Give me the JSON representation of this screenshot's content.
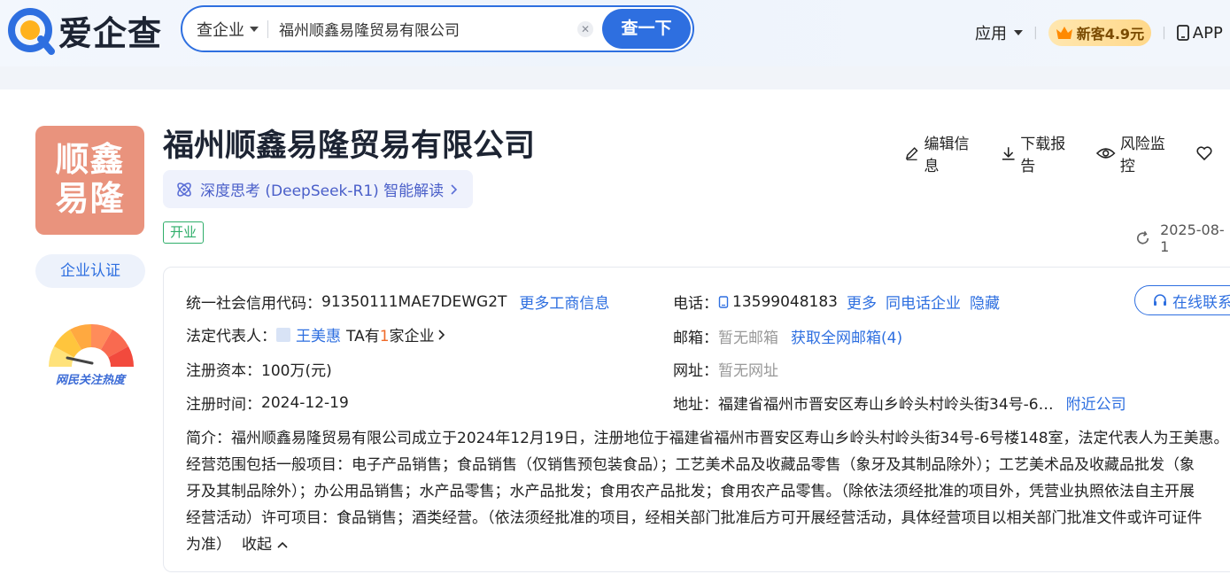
{
  "header": {
    "logo_text": "爱企查",
    "search_type": "查企业",
    "search_value": "福州顺鑫易隆贸易有限公司",
    "search_button": "查一下",
    "apps_label": "应用",
    "vip_label": "新客4.9元",
    "app_label": "APP"
  },
  "company": {
    "logo_line1": "顺鑫",
    "logo_line2": "易隆",
    "name": "福州顺鑫易隆贸易有限公司",
    "ai_label": "深度思考 (DeepSeek-R1) 智能解读",
    "status": "开业",
    "cert_label": "企业认证",
    "heat_label": "网民关注热度",
    "update_date": "2025-08-1"
  },
  "actions": {
    "edit": "编辑信息",
    "download": "下载报告",
    "monitor": "风险监控"
  },
  "info": {
    "credit_code_label": "统一社会信用代码：",
    "credit_code": "91350111MAE7DEWG2T",
    "more_business": "更多工商信息",
    "legal_rep_label": "法定代表人：",
    "legal_rep": "王美惠",
    "ta_prefix": "TA有",
    "ta_count": "1",
    "ta_suffix": "家企业",
    "capital_label": "注册资本：",
    "capital": "100万(元)",
    "reg_date_label": "注册时间：",
    "reg_date": "2024-12-19",
    "phone_label": "电话：",
    "phone": "13599048183",
    "phone_more": "更多",
    "same_phone": "同电话企业",
    "hide": "隐藏",
    "email_label": "邮箱：",
    "email": "暂无邮箱",
    "get_email": "获取全网邮箱(4)",
    "website_label": "网址：",
    "website": "暂无网址",
    "address_label": "地址：",
    "address": "福建省福州市晋安区寿山乡岭头村岭头街34号-6…",
    "nearby": "附近公司",
    "contact_button": "在线联系"
  },
  "intro": {
    "line1": "简介：福州顺鑫易隆贸易有限公司成立于2024年12月19日，注册地位于福建省福州市晋安区寿山乡岭头村岭头街34号-6号楼148室，法定代表人为王美惠。",
    "line2": "经营范围包括一般项目：电子产品销售；食品销售（仅销售预包装食品）；工艺美术品及收藏品零售（象牙及其制品除外）；工艺美术品及收藏品批发（象",
    "line3": "牙及其制品除外）；办公用品销售；水产品零售；水产品批发；食用农产品批发；食用农产品零售。（除依法须经批准的项目外，凭营业执照依法自主开展",
    "line4": "经营活动）许可项目：食品销售；酒类经营。（依法须经批准的项目，经相关部门批准后方可开展经营活动，具体经营项目以相关部门批准文件或许可证件",
    "line5": "为准）",
    "collapse": "收起"
  },
  "colors": {
    "brand_blue": "#2e6fe0",
    "logo_bg": "#e9937d",
    "status_green": "#2fae6a"
  }
}
